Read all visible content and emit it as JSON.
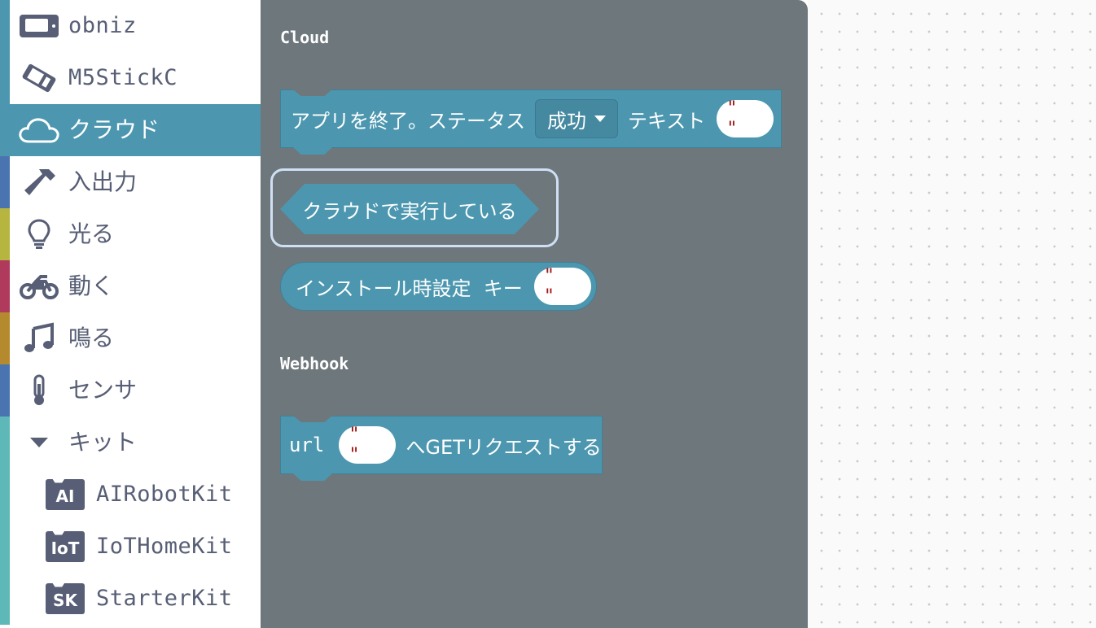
{
  "sidebar": {
    "categories": [
      {
        "label": "obniz",
        "icon": "obniz-board-icon",
        "stripe": "#4c97af",
        "mono": true
      },
      {
        "label": "M5StickC",
        "icon": "m5stickc-device-icon",
        "stripe": "#4c97af",
        "mono": true
      },
      {
        "label": "クラウド",
        "icon": "cloud-icon",
        "stripe": "#4c97af",
        "selected": true
      },
      {
        "label": "入出力",
        "icon": "hammer-icon",
        "stripe": "#4a74b0"
      },
      {
        "label": "光る",
        "icon": "lightbulb-icon",
        "stripe": "#b5b540"
      },
      {
        "label": "動く",
        "icon": "motorcycle-icon",
        "stripe": "#b03a5b"
      },
      {
        "label": "鳴る",
        "icon": "music-note-icon",
        "stripe": "#b5892e"
      },
      {
        "label": "センサ",
        "icon": "thermometer-icon",
        "stripe": "#4a74b0"
      },
      {
        "label": "キット",
        "icon": "caret-down-icon",
        "stripe": "#5fb8b8"
      }
    ],
    "kits": [
      {
        "label": "AIRobotKit",
        "badge": "AI",
        "stripe": "#5fb8b8"
      },
      {
        "label": "IoTHomeKit",
        "badge": "IoT",
        "stripe": "#5fb8b8"
      },
      {
        "label": "StarterKit",
        "badge": "SK",
        "stripe": "#5fb8b8"
      }
    ]
  },
  "flyout": {
    "cloud_title": "Cloud",
    "exit_block": {
      "text1": "アプリを終了。ステータス",
      "dropdown": "成功",
      "text2": "テキスト",
      "string_value": "\" \""
    },
    "running_block": {
      "text": "クラウドで実行している"
    },
    "install_block": {
      "text": "インストール時設定  キー",
      "string_value": "\" \""
    },
    "webhook_title": "Webhook",
    "webhook_block": {
      "text1": "url",
      "string_value": "\" \"",
      "text2": "へGETリクエストする"
    }
  },
  "colors": {
    "accent": "#4c97af",
    "flyout_bg": "#6e777c",
    "text": "#575e75"
  }
}
